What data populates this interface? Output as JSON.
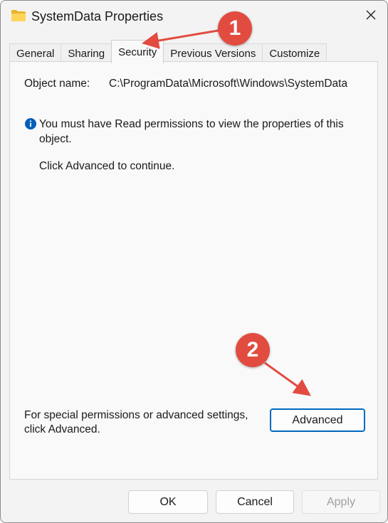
{
  "window": {
    "title": "SystemData Properties"
  },
  "tabs": [
    {
      "label": "General",
      "active": false
    },
    {
      "label": "Sharing",
      "active": false
    },
    {
      "label": "Security",
      "active": true
    },
    {
      "label": "Previous Versions",
      "active": false
    },
    {
      "label": "Customize",
      "active": false
    }
  ],
  "security": {
    "object_name_label": "Object name:",
    "object_name_value": "C:\\ProgramData\\Microsoft\\Windows\\SystemData",
    "info_message": "You must have Read permissions to view the properties of this object.",
    "continue_message": "Click Advanced to continue.",
    "special_message": "For special permissions or advanced settings, click Advanced.",
    "advanced_button": "Advanced"
  },
  "footer": {
    "ok_label": "OK",
    "cancel_label": "Cancel",
    "apply_label": "Apply"
  },
  "annotations": {
    "badge_1": "1",
    "badge_2": "2",
    "color": "#e24b3f"
  },
  "icons": {
    "folder": "folder-icon",
    "close": "close-icon",
    "info": "info-icon"
  }
}
